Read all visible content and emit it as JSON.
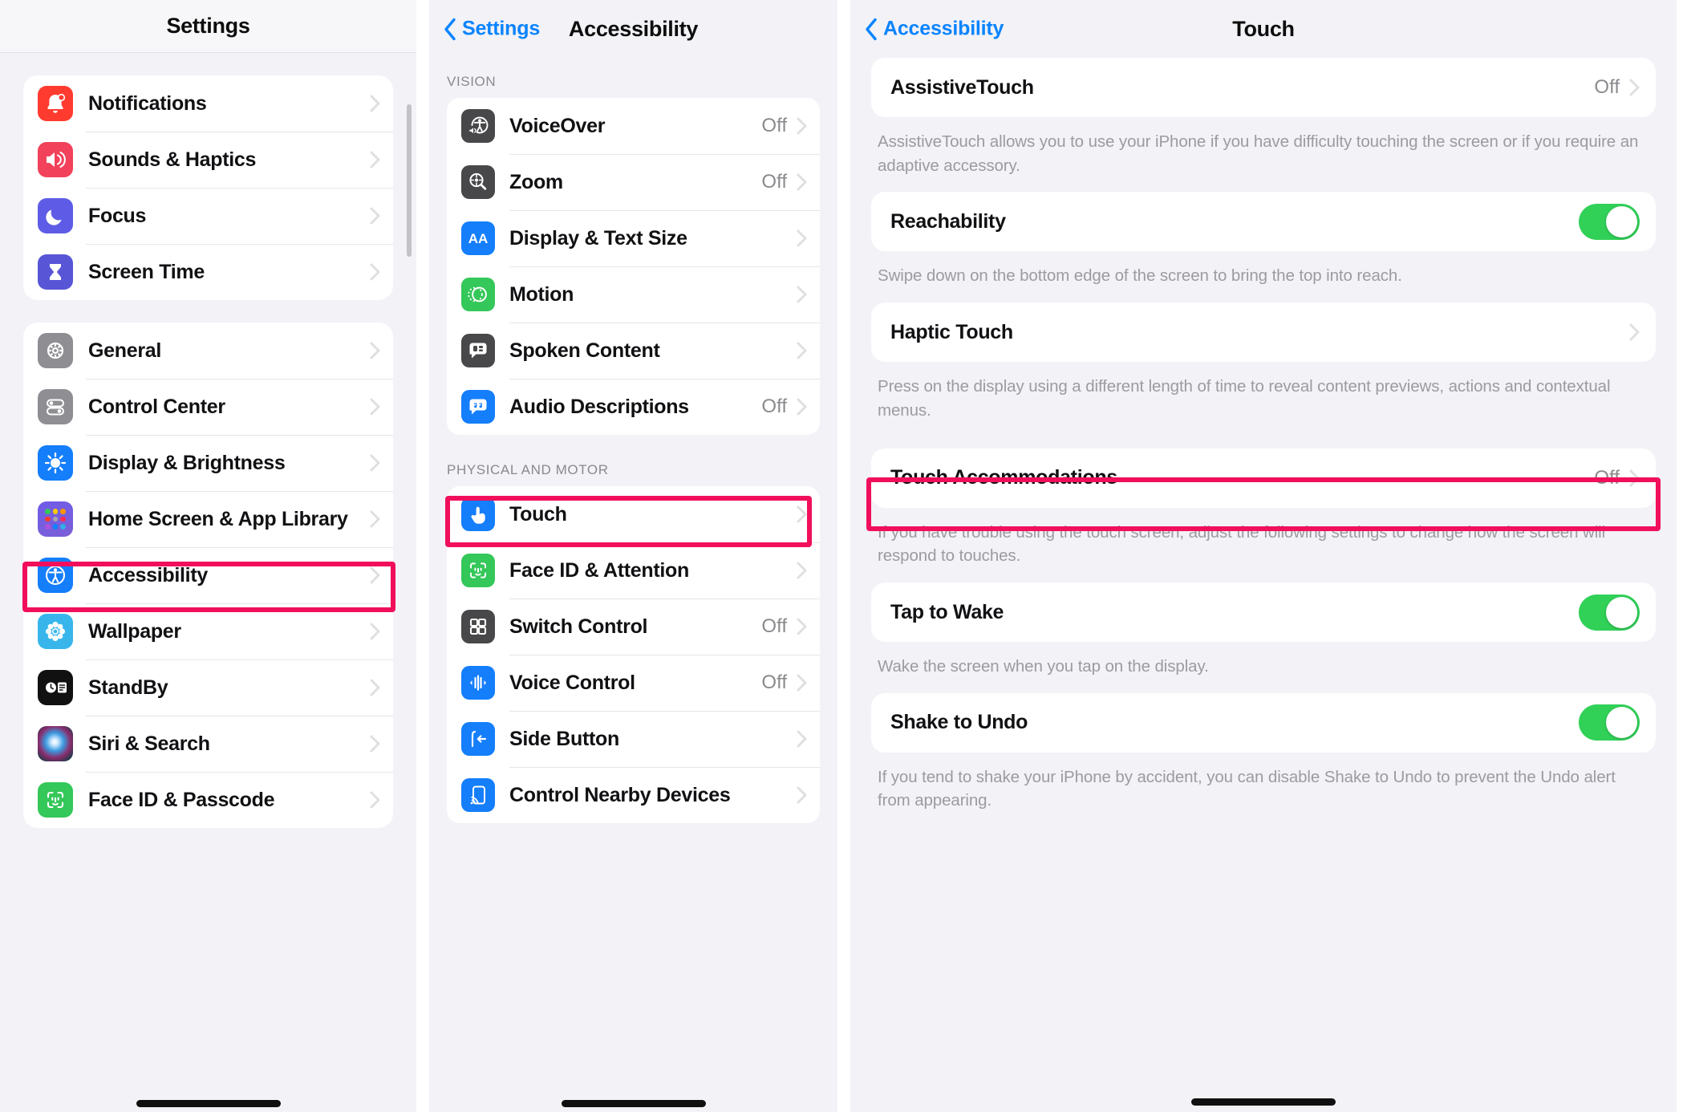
{
  "panel1": {
    "nav": {
      "title": "Settings"
    },
    "groups": [
      {
        "items": [
          {
            "label": "Notifications",
            "icon": "notifications-icon",
            "icon_bg": "#ff3b30",
            "chevron": true
          },
          {
            "label": "Sounds & Haptics",
            "icon": "sounds-haptics-icon",
            "icon_bg": "#f2415a",
            "chevron": true
          },
          {
            "label": "Focus",
            "icon": "focus-icon",
            "icon_bg": "#5e5ce6",
            "chevron": true
          },
          {
            "label": "Screen Time",
            "icon": "screen-time-icon",
            "icon_bg": "#5856d6",
            "chevron": true
          }
        ]
      },
      {
        "items": [
          {
            "label": "General",
            "icon": "gear-icon",
            "icon_bg": "#8e8e93",
            "chevron": true
          },
          {
            "label": "Control Center",
            "icon": "control-center-icon",
            "icon_bg": "#8e8e93",
            "chevron": true
          },
          {
            "label": "Display & Brightness",
            "icon": "brightness-icon",
            "icon_bg": "#147efb",
            "chevron": true
          },
          {
            "label": "Home Screen & App Library",
            "icon": "home-screen-icon",
            "icon_bg": "#5f5ae0",
            "chevron": true
          },
          {
            "label": "Accessibility",
            "icon": "accessibility-icon",
            "icon_bg": "#147efb",
            "chevron": true,
            "highlighted": true
          },
          {
            "label": "Wallpaper",
            "icon": "wallpaper-icon",
            "icon_bg": "#38b6ec",
            "chevron": true
          },
          {
            "label": "StandBy",
            "icon": "standby-icon",
            "icon_bg": "#111111",
            "chevron": true
          },
          {
            "label": "Siri & Search",
            "icon": "siri-icon",
            "icon_bg": "#2b2130",
            "chevron": true
          },
          {
            "label": "Face ID & Passcode",
            "icon": "face-id-icon",
            "icon_bg": "#34c759",
            "chevron": true
          }
        ]
      }
    ]
  },
  "panel2": {
    "nav": {
      "back": "Settings",
      "title": "Accessibility"
    },
    "sections": [
      {
        "header": "VISION",
        "items": [
          {
            "label": "VoiceOver",
            "value": "Off",
            "icon": "voiceover-icon",
            "icon_bg": "#48484a",
            "chevron": true
          },
          {
            "label": "Zoom",
            "value": "Off",
            "icon": "zoom-magnifier-icon",
            "icon_bg": "#48484a",
            "chevron": true
          },
          {
            "label": "Display & Text Size",
            "value": "",
            "icon": "text-size-icon",
            "icon_bg": "#147efb",
            "chevron": true
          },
          {
            "label": "Motion",
            "value": "",
            "icon": "motion-icon",
            "icon_bg": "#34c759",
            "chevron": true
          },
          {
            "label": "Spoken Content",
            "value": "",
            "icon": "spoken-content-icon",
            "icon_bg": "#48484a",
            "chevron": true
          },
          {
            "label": "Audio Descriptions",
            "value": "Off",
            "icon": "audio-descriptions-icon",
            "icon_bg": "#147efb",
            "chevron": true
          }
        ]
      },
      {
        "header": "PHYSICAL AND MOTOR",
        "items": [
          {
            "label": "Touch",
            "value": "",
            "icon": "touch-icon",
            "icon_bg": "#147efb",
            "chevron": true,
            "highlighted": true
          },
          {
            "label": "Face ID & Attention",
            "value": "",
            "icon": "face-id-icon",
            "icon_bg": "#34c759",
            "chevron": true
          },
          {
            "label": "Switch Control",
            "value": "Off",
            "icon": "switch-control-icon",
            "icon_bg": "#48484a",
            "chevron": true
          },
          {
            "label": "Voice Control",
            "value": "Off",
            "icon": "voice-control-icon",
            "icon_bg": "#147efb",
            "chevron": true
          },
          {
            "label": "Side Button",
            "value": "",
            "icon": "side-button-icon",
            "icon_bg": "#147efb",
            "chevron": true
          },
          {
            "label": "Control Nearby Devices",
            "value": "",
            "icon": "control-nearby-devices-icon",
            "icon_bg": "#147efb",
            "chevron": true
          }
        ]
      }
    ]
  },
  "panel3": {
    "nav": {
      "back": "Accessibility",
      "title": "Touch"
    },
    "blocks": [
      {
        "type": "row",
        "label": "AssistiveTouch",
        "value": "Off",
        "chevron": true,
        "footnote": "AssistiveTouch allows you to use your iPhone if you have difficulty touching the screen or if you require an adaptive accessory."
      },
      {
        "type": "toggle",
        "label": "Reachability",
        "on": true,
        "footnote": "Swipe down on the bottom edge of the screen to bring the top into reach."
      },
      {
        "type": "row",
        "label": "Haptic Touch",
        "value": "",
        "chevron": true,
        "footnote": "Press on the display using a different length of time to reveal content previews, actions and contextual menus."
      },
      {
        "type": "row",
        "label": "Touch Accommodations",
        "value": "Off",
        "chevron": true,
        "highlighted": true,
        "footnote": "If you have trouble using the touch screen, adjust the following settings to change how the screen will respond to touches."
      },
      {
        "type": "toggle",
        "label": "Tap to Wake",
        "on": true,
        "footnote": "Wake the screen when you tap on the display."
      },
      {
        "type": "toggle",
        "label": "Shake to Undo",
        "on": true,
        "footnote": "If you tend to shake your iPhone by accident, you can disable Shake to Undo to prevent the Undo alert from appearing."
      }
    ]
  },
  "colors": {
    "highlight": "#f10f5c",
    "accent_blue": "#0a84ff",
    "toggle_on_green": "#31d158",
    "value_gray": "#8a8a8e"
  }
}
